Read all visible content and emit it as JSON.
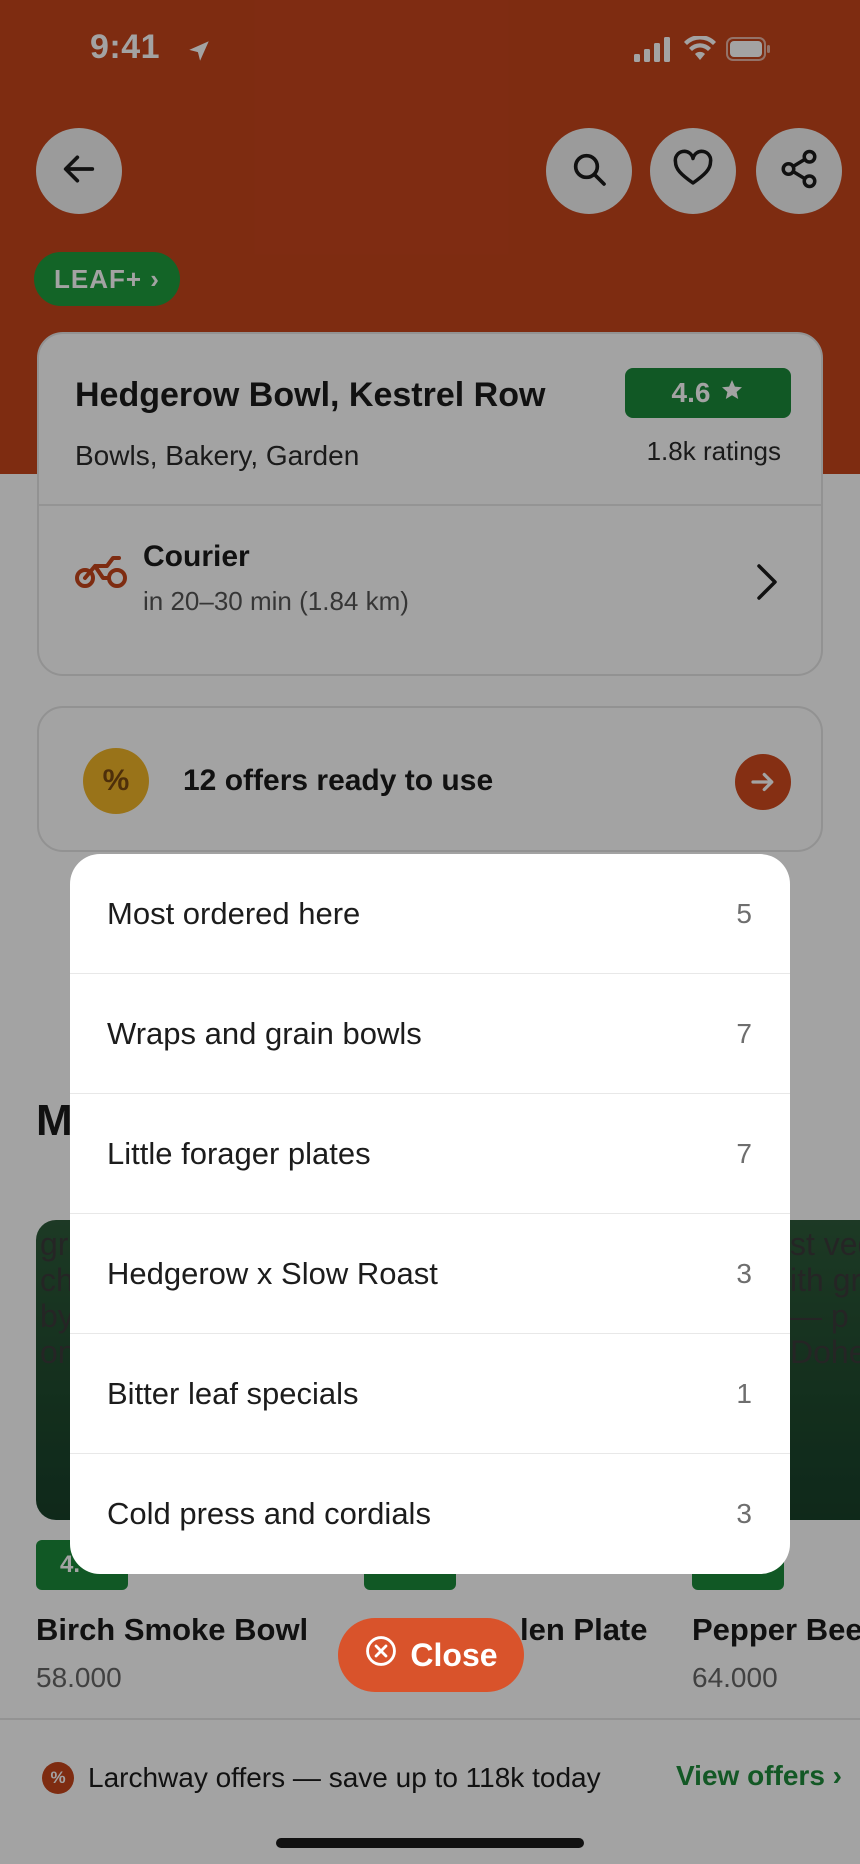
{
  "status_bar": {
    "time": "9:41"
  },
  "header": {
    "back_icon": "arrow-left-icon",
    "actions": [
      "search-icon",
      "heart-icon",
      "share-icon"
    ],
    "membership_badge": "LEAF+ ›"
  },
  "restaurant": {
    "name": "Hedgerow Bowl, Kestrel Row",
    "cuisines": "Bowls, Bakery, Garden",
    "rating": "4.6",
    "ratings_count": "1.8k ratings",
    "delivery_mode": "Courier",
    "delivery_eta": "in 20–30 min (1.84 km)"
  },
  "offers": {
    "icon_label": "%",
    "text": "12 offers ready to use"
  },
  "section": {
    "title_visible": "M"
  },
  "dishes": [
    {
      "name": "Birch Smoke Bowl",
      "price": "58.000",
      "rating": "4.",
      "image_alt": "gr\nch\nby\non"
    },
    {
      "name": "len Plate",
      "price": "",
      "rating": "4.",
      "image_alt": ""
    },
    {
      "name": "Pepper Bee",
      "price": "64.000",
      "rating": "4.",
      "image_alt": "st veg\nith gr\n — p\nDohe"
    }
  ],
  "menu_sheet": {
    "items": [
      {
        "label": "Most ordered here",
        "count": "5"
      },
      {
        "label": "Wraps and grain bowls",
        "count": "7"
      },
      {
        "label": "Little forager plates",
        "count": "7"
      },
      {
        "label": "Hedgerow x Slow Roast",
        "count": "3"
      },
      {
        "label": "Bitter leaf specials",
        "count": "1"
      },
      {
        "label": "Cold press and cordials",
        "count": "3"
      }
    ],
    "close_label": "Close"
  },
  "promo_bar": {
    "text": "Larchway offers — save up to 118k today",
    "link": "View offers ›"
  },
  "colors": {
    "brand": "#C6451C",
    "rating_green": "#1b8a3a",
    "offer_yellow": "#F0B428",
    "close_button": "#D9532B"
  }
}
